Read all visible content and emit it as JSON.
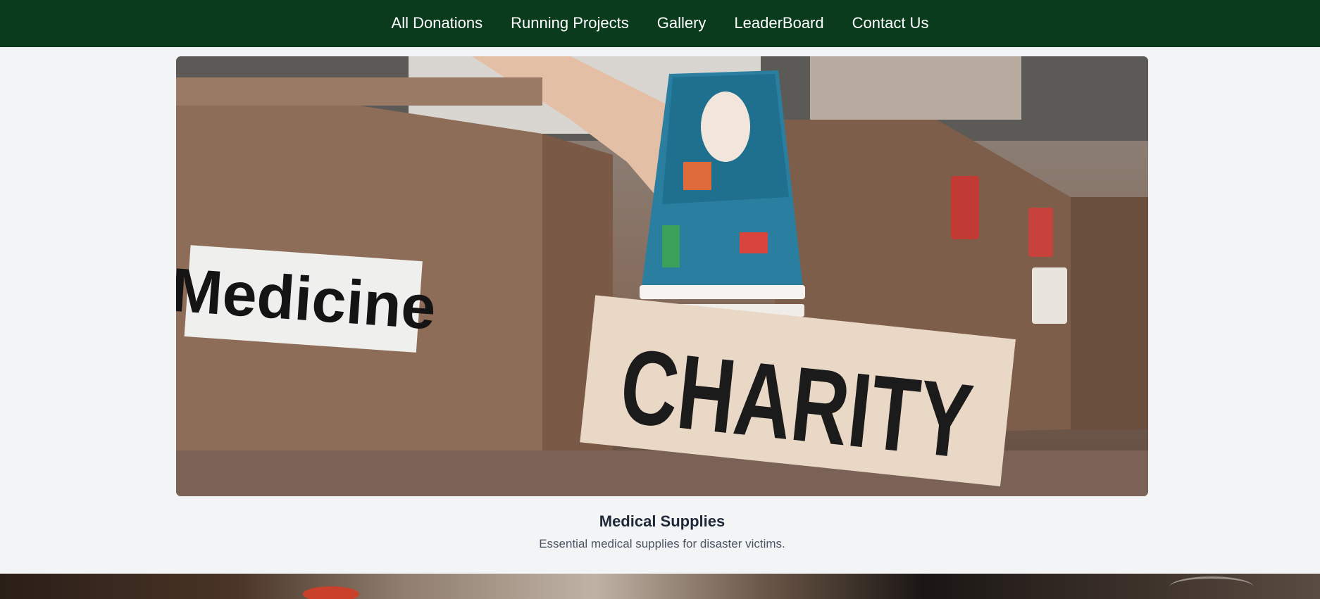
{
  "nav": {
    "items": [
      {
        "label": "All Donations"
      },
      {
        "label": "Running Projects"
      },
      {
        "label": "Gallery"
      },
      {
        "label": "LeaderBoard"
      },
      {
        "label": "Contact Us"
      }
    ]
  },
  "hero": {
    "box_label_text": "Medicine",
    "sign_text": "CHARITY"
  },
  "caption": {
    "title": "Medical Supplies",
    "description": "Essential medical supplies for disaster victims."
  }
}
